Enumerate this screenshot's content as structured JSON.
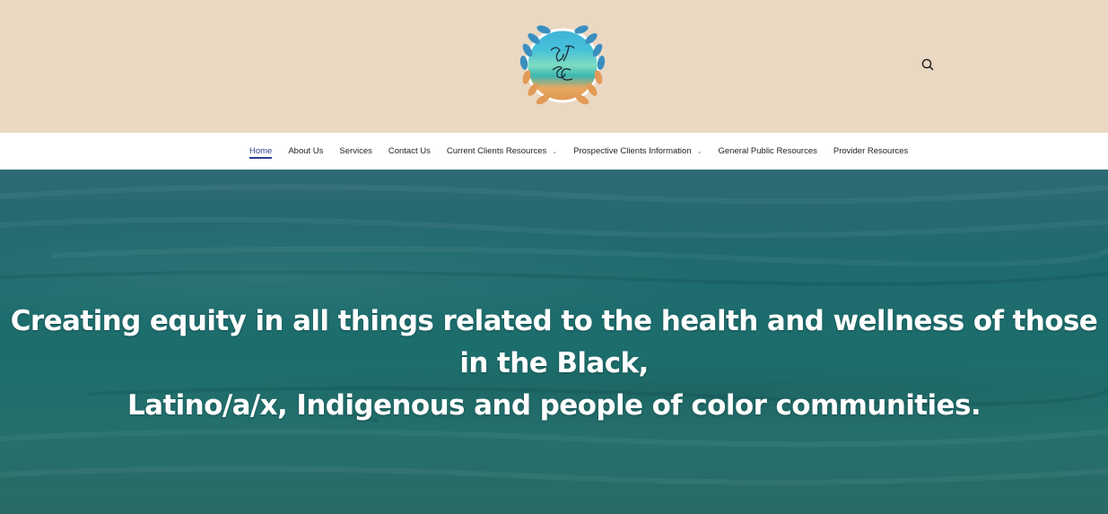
{
  "header": {
    "logo_alt": "BT&C logo",
    "search_icon": "search-icon"
  },
  "nav": {
    "items": [
      {
        "label": "Home",
        "active": true,
        "dropdown": false
      },
      {
        "label": "About Us",
        "active": false,
        "dropdown": false
      },
      {
        "label": "Services",
        "active": false,
        "dropdown": false
      },
      {
        "label": "Contact Us",
        "active": false,
        "dropdown": false
      },
      {
        "label": "Current Clients Resources",
        "active": false,
        "dropdown": true
      },
      {
        "label": "Prospective Clients Information",
        "active": false,
        "dropdown": true
      },
      {
        "label": "General Public Resources",
        "active": false,
        "dropdown": false
      },
      {
        "label": "Provider Resources",
        "active": false,
        "dropdown": false
      }
    ],
    "chevron_icon": "chevron-down-icon"
  },
  "hero": {
    "heading_line1": "Creating equity in all things related to the health and wellness of those in the Black,",
    "heading_line2": "Latino/a/x, Indigenous and people of color communities."
  },
  "colors": {
    "header_bg": "#ead8c3",
    "accent": "#2b3f8f",
    "hero_teal": "#1f6a6e"
  }
}
